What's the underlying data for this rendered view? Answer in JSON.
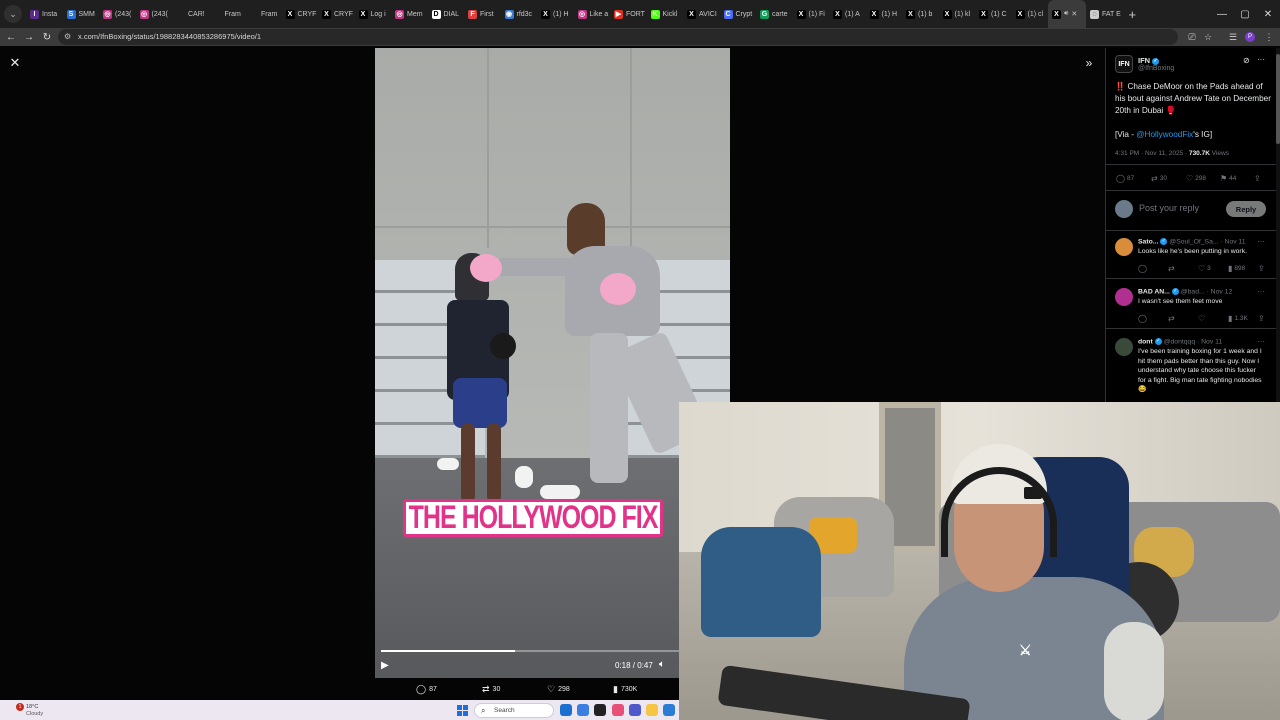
{
  "browser": {
    "tabs": [
      {
        "label": "Insta",
        "fav_color": "#5b2b8c",
        "fav_glyph": "I"
      },
      {
        "label": "SMM",
        "fav_color": "#2a6fd6",
        "fav_glyph": "S"
      },
      {
        "label": "(243(",
        "fav_color": "#c13584",
        "fav_glyph": "◎"
      },
      {
        "label": "(243(",
        "fav_color": "#c13584",
        "fav_glyph": "◎"
      },
      {
        "label": "CAR!",
        "fav_color": "#1f1f1f",
        "fav_glyph": ""
      },
      {
        "label": "Fram",
        "fav_color": "#1f1f1f",
        "fav_glyph": ""
      },
      {
        "label": "Fram",
        "fav_color": "#1f1f1f",
        "fav_glyph": ""
      },
      {
        "label": "CRYF",
        "fav_color": "#000000",
        "fav_glyph": "X"
      },
      {
        "label": "CRYF",
        "fav_color": "#000000",
        "fav_glyph": "X"
      },
      {
        "label": "Log i",
        "fav_color": "#000000",
        "fav_glyph": "X"
      },
      {
        "label": "Mem",
        "fav_color": "#c13584",
        "fav_glyph": "◎"
      },
      {
        "label": "DIAL",
        "fav_color": "#ffffff",
        "fav_glyph": "D"
      },
      {
        "label": "First",
        "fav_color": "#e04040",
        "fav_glyph": "F"
      },
      {
        "label": "rfd3c",
        "fav_color": "#3a7bd5",
        "fav_glyph": "◉"
      },
      {
        "label": "(1) H",
        "fav_color": "#000000",
        "fav_glyph": "X"
      },
      {
        "label": "Like a",
        "fav_color": "#c13584",
        "fav_glyph": "◎"
      },
      {
        "label": "FORT",
        "fav_color": "#e0301e",
        "fav_glyph": "▶"
      },
      {
        "label": "Kickl",
        "fav_color": "#53fc18",
        "fav_glyph": "K"
      },
      {
        "label": "AVICI",
        "fav_color": "#000000",
        "fav_glyph": "X"
      },
      {
        "label": "Crypt",
        "fav_color": "#4a6cf7",
        "fav_glyph": "C"
      },
      {
        "label": "carte",
        "fav_color": "#0f9d58",
        "fav_glyph": "G"
      },
      {
        "label": "(1) Fi",
        "fav_color": "#000000",
        "fav_glyph": "X"
      },
      {
        "label": "(1) A",
        "fav_color": "#000000",
        "fav_glyph": "X"
      },
      {
        "label": "(1) H",
        "fav_color": "#000000",
        "fav_glyph": "X"
      },
      {
        "label": "(1) b",
        "fav_color": "#000000",
        "fav_glyph": "X"
      },
      {
        "label": "(1) kl",
        "fav_color": "#000000",
        "fav_glyph": "X"
      },
      {
        "label": "(1) C",
        "fav_color": "#000000",
        "fav_glyph": "X"
      },
      {
        "label": "(1) cl",
        "fav_color": "#000000",
        "fav_glyph": "X"
      },
      {
        "label": "",
        "fav_color": "#000000",
        "fav_glyph": "X",
        "active": true
      },
      {
        "label": "FAT E",
        "fav_color": "#cccccc",
        "fav_glyph": "◌"
      }
    ],
    "active_tab_icon": "speaker-icon",
    "url": "x.com/IfnBoxing/status/1988283440853286975/video/1"
  },
  "video": {
    "overlay_text": "THE HOLLYWOOD FIX",
    "time": "0:18 / 0:47",
    "progress": 0.45
  },
  "video_stats": {
    "replies": "87",
    "reposts": "30",
    "likes": "298",
    "views": "730K"
  },
  "tweet": {
    "author_name": "IFN",
    "author_handle": "@IfnBoxing",
    "text_line1": "‼️ Chase DeMoor on the Pads ahead of his bout against Andrew Tate on December 20th in Dubai 🥊",
    "via_prefix": "[Via - ",
    "via_link": "@HollywoodFix",
    "via_suffix": "'s IG]",
    "timestamp": "4:31 PM · Nov 11, 2025 · ",
    "views_count": "730.7K",
    "views_label": " Views",
    "actions": {
      "replies": "87",
      "reposts": "30",
      "likes": "298",
      "bookmarks": "44"
    },
    "reply_placeholder": "Post your reply",
    "reply_button": "Reply"
  },
  "replies": [
    {
      "name": "Sato...",
      "handle": "@Soul_Of_Sa...",
      "date": "· Nov 11",
      "text": "Looks like he's been putting in work.",
      "likes": "3",
      "views": "898",
      "avatar_color": "#d98c3a"
    },
    {
      "name": "BAD AN...",
      "handle": "@bad...",
      "date": "· Nov 12",
      "text": "I wasn't see them feet move",
      "likes": "",
      "views": "1.3K",
      "avatar_color": "#b03090"
    },
    {
      "name": "dont",
      "handle": "@dontqqq",
      "date": "· Nov 11",
      "text": "I've been training boxing for 1 week and I hit them pads better than this guy. Now I understand why tate choose this fucker for a fight. Big man tate fighting nobodies 😂",
      "likes": "",
      "views": "",
      "avatar_color": "#3a4a3a"
    }
  ],
  "taskbar": {
    "weather_temp": "18°C",
    "weather_cond": "Cloudy",
    "weather_badge": "1",
    "search_label": "Search"
  },
  "colors": {
    "accent": "#1d9bf0",
    "logo_pink": "#e2338a"
  }
}
